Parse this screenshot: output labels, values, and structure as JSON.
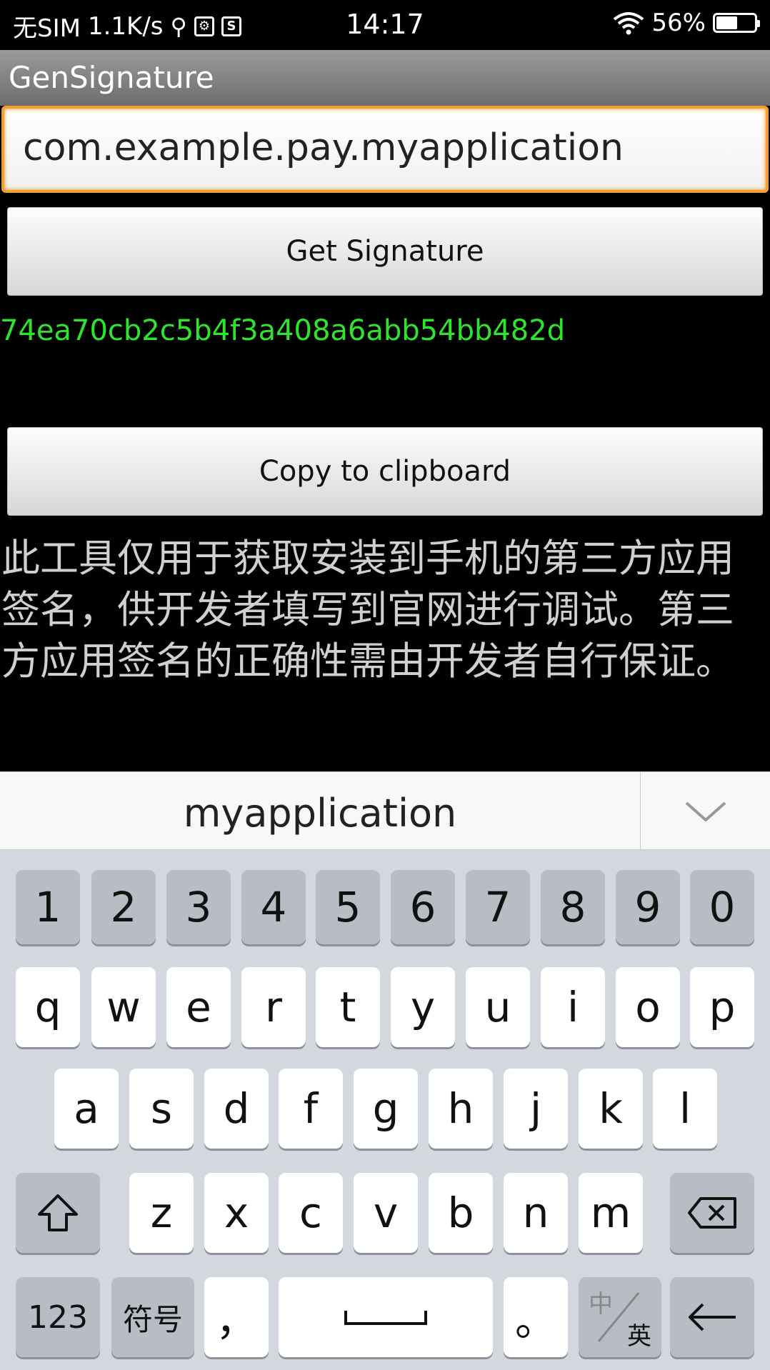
{
  "status_bar": {
    "carrier": "无SIM",
    "speed": "1.1K/s",
    "time": "14:17",
    "battery": "56%",
    "battery_level": 0.56
  },
  "app": {
    "title": "GenSignature"
  },
  "form": {
    "package_value": "com.example.pay.myapplication",
    "get_signature_label": "Get Signature",
    "signature_value": "74ea70cb2c5b4f3a408a6abb54bb482d",
    "copy_label": "Copy to clipboard",
    "description": "此工具仅用于获取安装到手机的第三方应用签名，供开发者填写到官网进行调试。第三方应用签名的正确性需由开发者自行保证。"
  },
  "keyboard": {
    "suggestion": "myapplication",
    "row_numbers": [
      "1",
      "2",
      "3",
      "4",
      "5",
      "6",
      "7",
      "8",
      "9",
      "0"
    ],
    "row1": [
      "q",
      "w",
      "e",
      "r",
      "t",
      "y",
      "u",
      "i",
      "o",
      "p"
    ],
    "row2": [
      "a",
      "s",
      "d",
      "f",
      "g",
      "h",
      "j",
      "k",
      "l"
    ],
    "row3": [
      "z",
      "x",
      "c",
      "v",
      "b",
      "n",
      "m"
    ],
    "key_123": "123",
    "key_symbols": "符号",
    "key_comma": "，",
    "key_period": "。",
    "key_lang_top": "中",
    "key_lang_bottom": "英"
  },
  "colors": {
    "accent_focus": "#f0a030",
    "signature_green": "#2ee52e"
  }
}
